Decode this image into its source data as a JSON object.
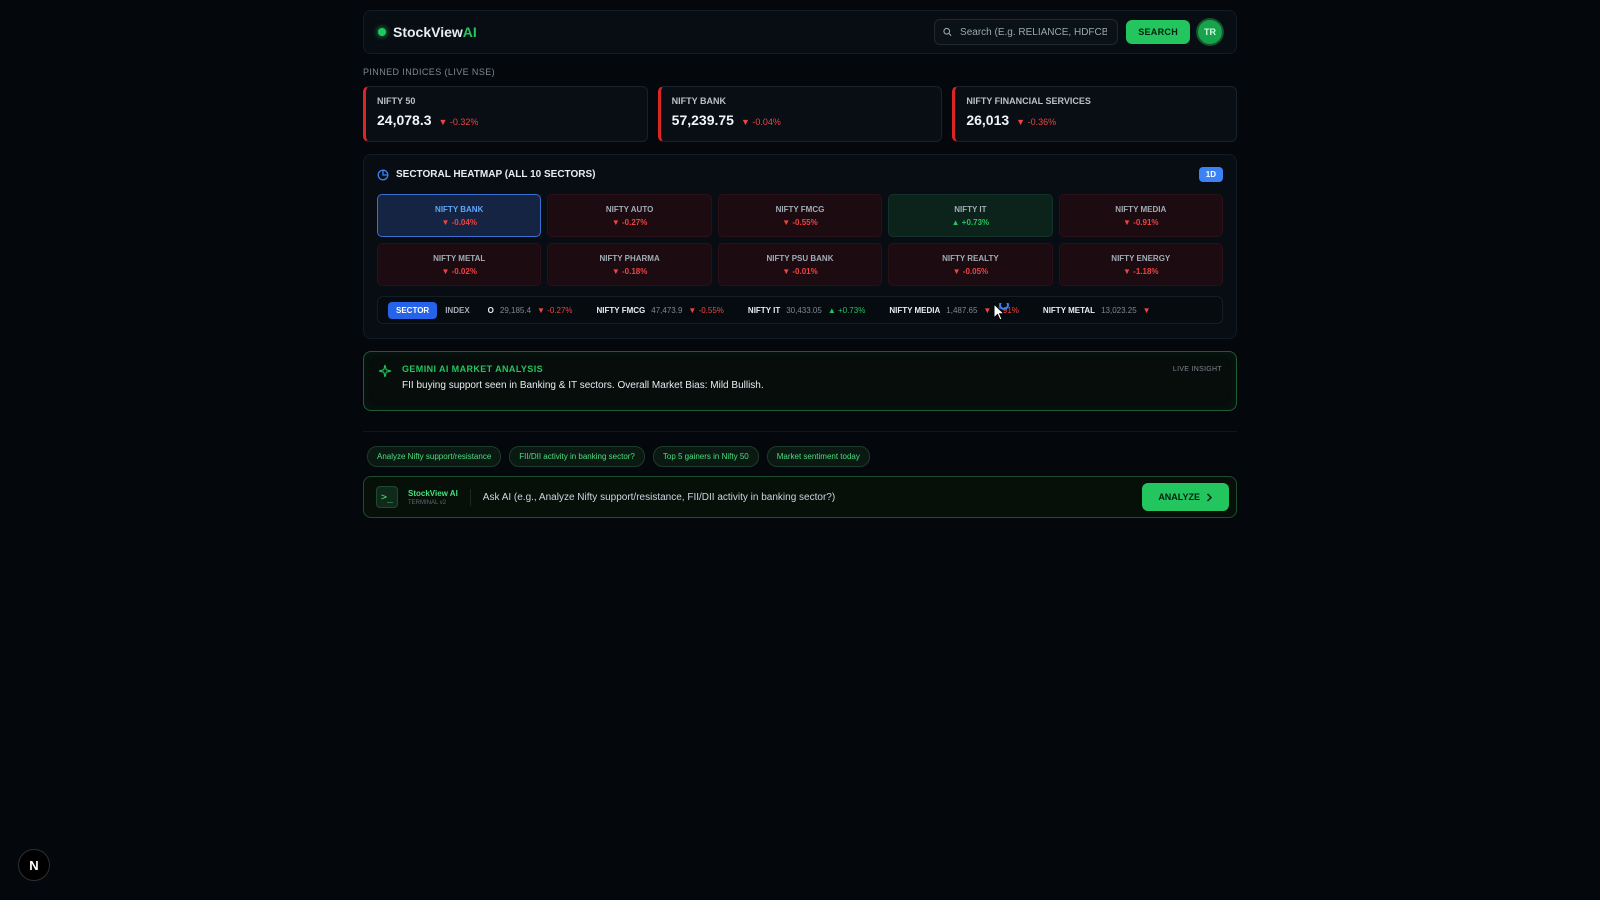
{
  "header": {
    "brand_main": "StockView",
    "brand_accent": "AI",
    "search_placeholder": "Search (E.g. RELIANCE, HDFCBANK)",
    "search_button": "SEARCH",
    "avatar_initials": "TR"
  },
  "pinned": {
    "label": "PINNED INDICES (LIVE NSE)",
    "cards": [
      {
        "name": "NIFTY 50",
        "value": "24,078.3",
        "change": "-0.32%"
      },
      {
        "name": "NIFTY BANK",
        "value": "57,239.75",
        "change": "-0.04%"
      },
      {
        "name": "NIFTY FINANCIAL SERVICES",
        "value": "26,013",
        "change": "-0.36%"
      }
    ]
  },
  "heatmap": {
    "title": "SECTORAL HEATMAP (ALL 10 SECTORS)",
    "timeframe": "1D",
    "tiles": [
      {
        "name": "NIFTY BANK",
        "change": "▼ -0.04%"
      },
      {
        "name": "NIFTY AUTO",
        "change": "▼ -0.27%"
      },
      {
        "name": "NIFTY FMCG",
        "change": "▼ -0.55%"
      },
      {
        "name": "NIFTY IT",
        "change": "▲ +0.73%"
      },
      {
        "name": "NIFTY MEDIA",
        "change": "▼ -0.91%"
      },
      {
        "name": "NIFTY METAL",
        "change": "▼ -0.02%"
      },
      {
        "name": "NIFTY PHARMA",
        "change": "▼ -0.18%"
      },
      {
        "name": "NIFTY PSU BANK",
        "change": "▼ -0.01%"
      },
      {
        "name": "NIFTY REALTY",
        "change": "▼ -0.05%"
      },
      {
        "name": "NIFTY ENERGY",
        "change": "▼ -1.18%"
      }
    ],
    "ticker": {
      "toggle_sector": "SECTOR",
      "toggle_index": "INDEX",
      "items": [
        {
          "name": "O",
          "value": "29,185.4",
          "change": "▼ -0.27%"
        },
        {
          "name": "NIFTY FMCG",
          "value": "47,473.9",
          "change": "▼ -0.55%"
        },
        {
          "name": "NIFTY IT",
          "value": "30,433.05",
          "change": "▲ +0.73%"
        },
        {
          "name": "NIFTY MEDIA",
          "value": "1,487.65",
          "change": "▼ -0.91%"
        },
        {
          "name": "NIFTY METAL",
          "value": "13,023.25",
          "change": "▼"
        }
      ]
    }
  },
  "gemini": {
    "title": "GEMINI AI MARKET ANALYSIS",
    "text": "FII buying support seen in Banking & IT sectors. Overall Market Bias: Mild Bullish.",
    "badge": "LIVE INSIGHT"
  },
  "chips": [
    "Analyze Nifty support/resistance",
    "FII/DII activity in banking sector?",
    "Top 5 gainers in Nifty 50",
    "Market sentiment today"
  ],
  "ask": {
    "brand": "StockView AI",
    "version": "TERMINAL v2",
    "placeholder": "Ask AI (e.g., Analyze Nifty support/resistance, FII/DII activity in banking sector?)",
    "button": "ANALYZE"
  },
  "corner_badge": "N",
  "colors": {
    "accent": "#22c55e",
    "down": "#ef4444",
    "up": "#22c55e",
    "selected": "#3b82f6"
  }
}
